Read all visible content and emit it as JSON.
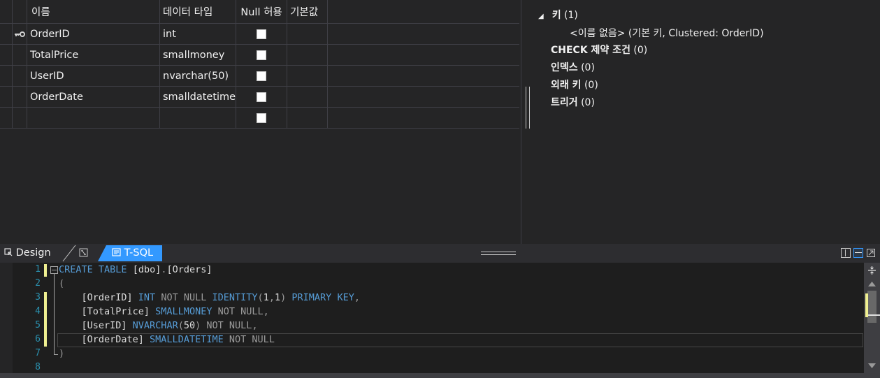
{
  "grid": {
    "headers": {
      "name": "이름",
      "type": "데이터 타입",
      "null": "Null 허용",
      "default": "기본값"
    },
    "rows": [
      {
        "name": "OrderID",
        "type": "int",
        "is_key": true
      },
      {
        "name": "TotalPrice",
        "type": "smallmoney",
        "is_key": false
      },
      {
        "name": "UserID",
        "type": "nvarchar(50)",
        "is_key": false
      },
      {
        "name": "OrderDate",
        "type": "smalldatetime",
        "is_key": false
      },
      {
        "name": "",
        "type": "",
        "is_key": false
      }
    ]
  },
  "properties": {
    "keys_label": "키",
    "keys_count": "(1)",
    "key_item": "<이름 없음>   (기본 키, Clustered: OrderID)",
    "check_label": "CHECK 제약 조건",
    "check_count": "(0)",
    "index_label": "인덱스",
    "index_count": "(0)",
    "fk_label": "외래 키",
    "fk_count": "(0)",
    "trigger_label": "트리거",
    "trigger_count": "(0)"
  },
  "tabs": {
    "design": "Design",
    "sql": "T-SQL"
  },
  "editor": {
    "line_numbers": [
      "1",
      "2",
      "3",
      "4",
      "5",
      "6",
      "7",
      "8"
    ],
    "lines": [
      "CREATE TABLE [dbo].[Orders]",
      "(",
      "    [OrderID] INT NOT NULL IDENTITY(1,1) PRIMARY KEY,",
      "    [TotalPrice] SMALLMONEY NOT NULL,",
      "    [UserID] NVARCHAR(50) NOT NULL,",
      "    [OrderDate] SMALLDATETIME NOT NULL",
      ")",
      ""
    ]
  },
  "colors": {
    "keyword": "#569cd6",
    "line_number": "#2b91af",
    "active_tab": "#3399ff",
    "change_marker": "#efef91"
  }
}
